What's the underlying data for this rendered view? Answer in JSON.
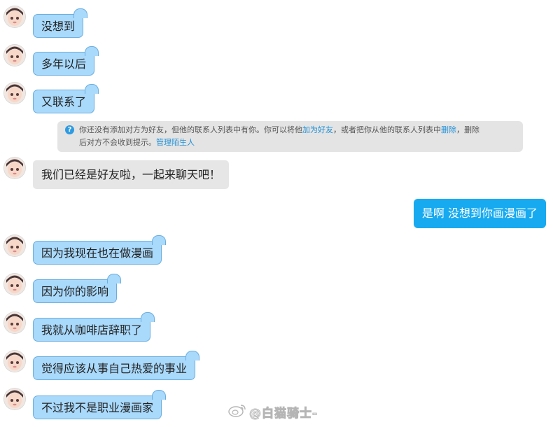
{
  "messages_before": [
    {
      "text": "没想到"
    },
    {
      "text": "多年以后"
    },
    {
      "text": "又联系了"
    }
  ],
  "notice": {
    "part1": "你还没有添加对方为好友，但他的联系人列表中有你。你可以将他",
    "link_add": "加为好友",
    "part2": "，或者把你从他的联系人列表中",
    "link_delete": "删除",
    "part3": "，删除",
    "part4": "后对方不会收到提示。",
    "link_manage": "管理陌生人"
  },
  "system_greeting": "我们已经是好友啦，一起来聊天吧！",
  "my_message": "是啊 没想到你画漫画了",
  "messages_after": [
    {
      "text": "因为我现在也在做漫画"
    },
    {
      "text": "因为你的影响"
    },
    {
      "text": "我就从咖啡店辞职了"
    },
    {
      "text": "觉得应该从事自己热爱的事业"
    },
    {
      "text": "不过我不是职业漫画家"
    }
  ],
  "watermark": {
    "text": "@白猫骑士-",
    "logo_icon": "weibo-logo-icon"
  },
  "colors": {
    "incoming_bubble": "#a9d9fb",
    "incoming_border": "#6aaee0",
    "outgoing_bubble": "#17aaf0",
    "system_bubble": "#e6e6e6",
    "link": "#1d8fd6"
  }
}
